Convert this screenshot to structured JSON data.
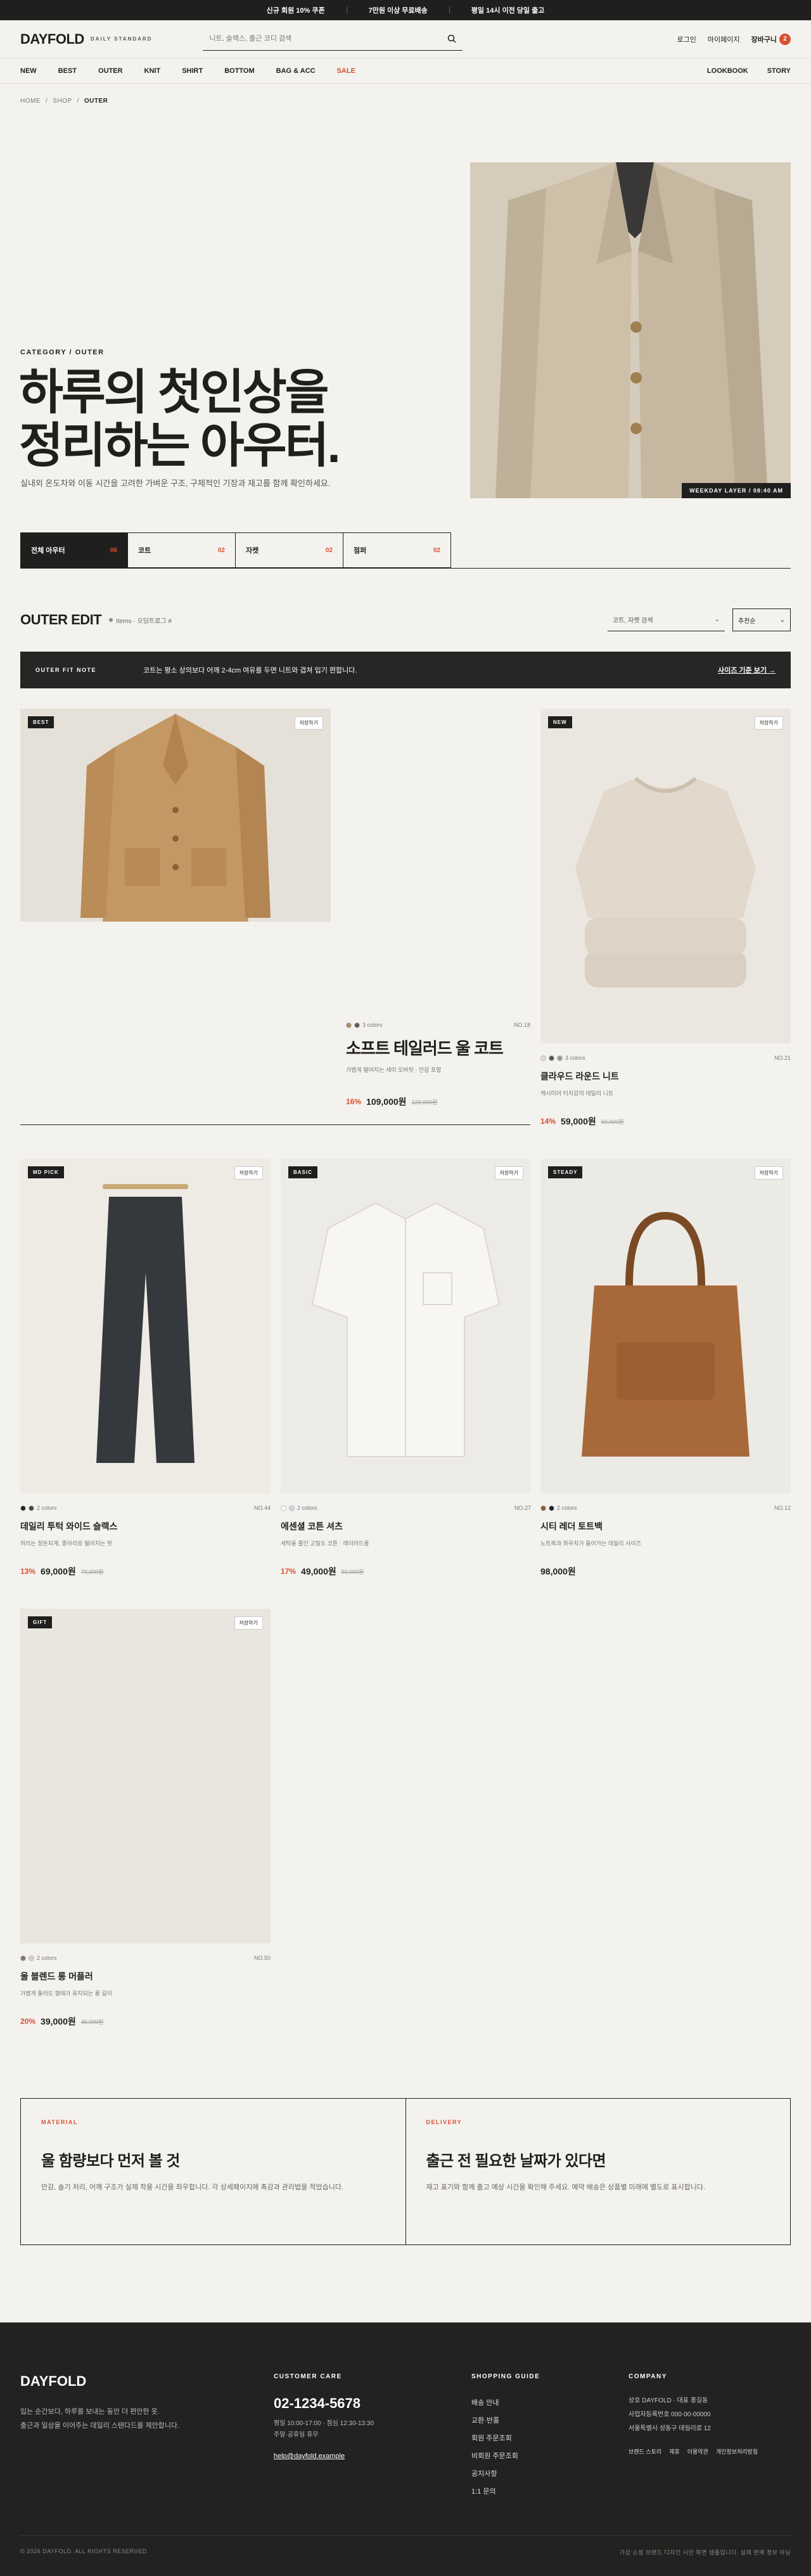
{
  "topbar": {
    "notices": [
      "신규 회원 10% 쿠폰",
      "7만원 이상 무료배송",
      "평일 14시 이전 당일 출고"
    ]
  },
  "header": {
    "logo": "DAYFOLD",
    "logo_sub": "DAILY STANDARD",
    "search_placeholder": "니트, 슬랙스, 출근 코디 검색",
    "login": "로그인",
    "mypage": "마이페이지",
    "cart": "장바구니",
    "cart_count": "2"
  },
  "nav": {
    "items": [
      "NEW",
      "BEST",
      "OUTER",
      "KNIT",
      "SHIRT",
      "BOTTOM",
      "BAG & ACC",
      "SALE"
    ],
    "right": [
      "LOOKBOOK",
      "STORY"
    ]
  },
  "breadcrumb": [
    "HOME",
    "SHOP",
    "OUTER"
  ],
  "hero": {
    "kicker": "CATEGORY / OUTER",
    "title_line1": "하루의 첫인상을",
    "title_line2": "정리하는 아우터.",
    "desc": "실내외 온도차와 이동 시간을 고려한 가벼운 구조, 구체적인 기장과 재고를 함께 확인하세요.",
    "caption": "WEEKDAY LAYER / 08:40 AM"
  },
  "categories": [
    {
      "label": "전체 아우터",
      "count": "06"
    },
    {
      "label": "코트",
      "count": "02"
    },
    {
      "label": "자켓",
      "count": "02"
    },
    {
      "label": "점퍼",
      "count": "02"
    }
  ],
  "list": {
    "title": "OUTER EDIT",
    "meta": "Items · 오딩트로그 #",
    "filter_label": "코트, 자켓 검색",
    "sort_label": "추천순"
  },
  "fit_note": {
    "label": "OUTER FIT NOTE",
    "text": "코트는 평소 상의보다 어깨 2-4cm 여유를 두면 니트와 겹쳐 입기 편합니다.",
    "link": "사이즈 기준 보기 →"
  },
  "products": [
    {
      "badge": "BEST",
      "wish": "저장하기",
      "colors": "3 colors",
      "sku": "NO.18",
      "name": "소프트 테일러드 울 코트",
      "desc": "가볍게 떨어지는 세미 오버핏 · 안감 포함",
      "discount": "16%",
      "price": "109,000원",
      "original": "129,000원",
      "swatches": [
        "#b08a5e",
        "#6a5a48"
      ]
    },
    {
      "badge": "NEW",
      "wish": "저장하기",
      "colors": "3 colors",
      "sku": "NO.21",
      "name": "클라우드 라운드 니트",
      "desc": "캐시미어 터치감의 데일리 니트",
      "discount": "14%",
      "price": "59,000원",
      "original": "69,000원",
      "swatches": [
        "#e2dbd0",
        "#555555",
        "#999999"
      ]
    },
    {
      "badge": "MD PICK",
      "wish": "저장하기",
      "colors": "2 colors",
      "sku": "NO.44",
      "name": "데일리 투턱 와이드 슬랙스",
      "desc": "허리는 정돈되게, 종아리로 떨어지는 핏",
      "discount": "13%",
      "price": "69,000원",
      "original": "79,000원",
      "swatches": [
        "#222222",
        "#444444"
      ]
    },
    {
      "badge": "BASIC",
      "wish": "저장하기",
      "colors": "2 colors",
      "sku": "NO.27",
      "name": "에센셜 코튼 셔츠",
      "desc": "세탁을 줄인 고밀도 코튼 · 레이어드용",
      "discount": "17%",
      "price": "49,000원",
      "original": "59,000원",
      "swatches": [
        "#ffffff",
        "#cfd6de"
      ]
    },
    {
      "badge": "STEADY",
      "wish": "저장하기",
      "colors": "2 colors",
      "sku": "NO.12",
      "name": "시티 레더 토트백",
      "desc": "노트북과 파우치가 들어가는 데일리 사이즈",
      "discount": "",
      "price": "98,000원",
      "original": "",
      "swatches": [
        "#8a5a30",
        "#1f1f1f"
      ]
    },
    {
      "badge": "GIFT",
      "wish": "저장하기",
      "colors": "2 colors",
      "sku": "NO.50",
      "name": "울 블렌드 롱 머플러",
      "desc": "가볍게 둘러도 형태가 유지되는 롱 길이",
      "discount": "20%",
      "price": "39,000원",
      "original": "49,000원",
      "swatches": [
        "#777777",
        "#d9cfc2"
      ]
    }
  ],
  "info": [
    {
      "kicker": "MATERIAL",
      "title": "울 함량보다 먼저 볼 것",
      "text": "안감, 솔기 처리, 어깨 구조가 실제 착용 시간을 좌우합니다. 각 상세페이지에 촉감과 관리법을 적었습니다."
    },
    {
      "kicker": "DELIVERY",
      "title": "출근 전 필요한 날짜가 있다면",
      "text": "재고 표기와 함께 출고 예상 시간을 확인해 주세요. 예약 배송은 상품별 미래에 별도로 표시합니다."
    }
  ],
  "footer": {
    "logo": "DAYFOLD",
    "desc_line1": "입는 순간보다, 하루를 보내는 동안 더 편안한 옷.",
    "desc_line2": "출근과 일상을 이어주는 데일리 스탠다드를 제안합니다.",
    "cs_head": "CUSTOMER CARE",
    "phone": "02-1234-5678",
    "hours": "평일 10:00-17:00 · 점심 12:30-13:30",
    "holiday": "주말·공휴일 휴무",
    "email": "help@dayfold.example",
    "guide_head": "SHOPPING GUIDE",
    "guide_links": [
      "배송 안내",
      "교환·반품",
      "회원 주문조회",
      "비회원 주문조회",
      "공지사항",
      "1:1 문의"
    ],
    "company_head": "COMPANY",
    "company_lines": [
      "상호 DAYFOLD · 대표 홍길동",
      "사업자등록번호 000-00-00000",
      "서울특별시 성동구 데일리로 12"
    ],
    "legal": [
      "브랜드 스토리",
      "제휴",
      "이용약관",
      "개인정보처리방침"
    ],
    "copyright": "© 2026 DAYFOLD. ALL RIGHTS RESERVED.",
    "note": "가상 쇼핑 브랜드 디자인 시안 화면 샘플입니다. 실제 판매 정보 아님"
  },
  "colors": {
    "accent": "#d84f32",
    "ink": "#1f1f1d",
    "bg": "#f4f2ee"
  }
}
